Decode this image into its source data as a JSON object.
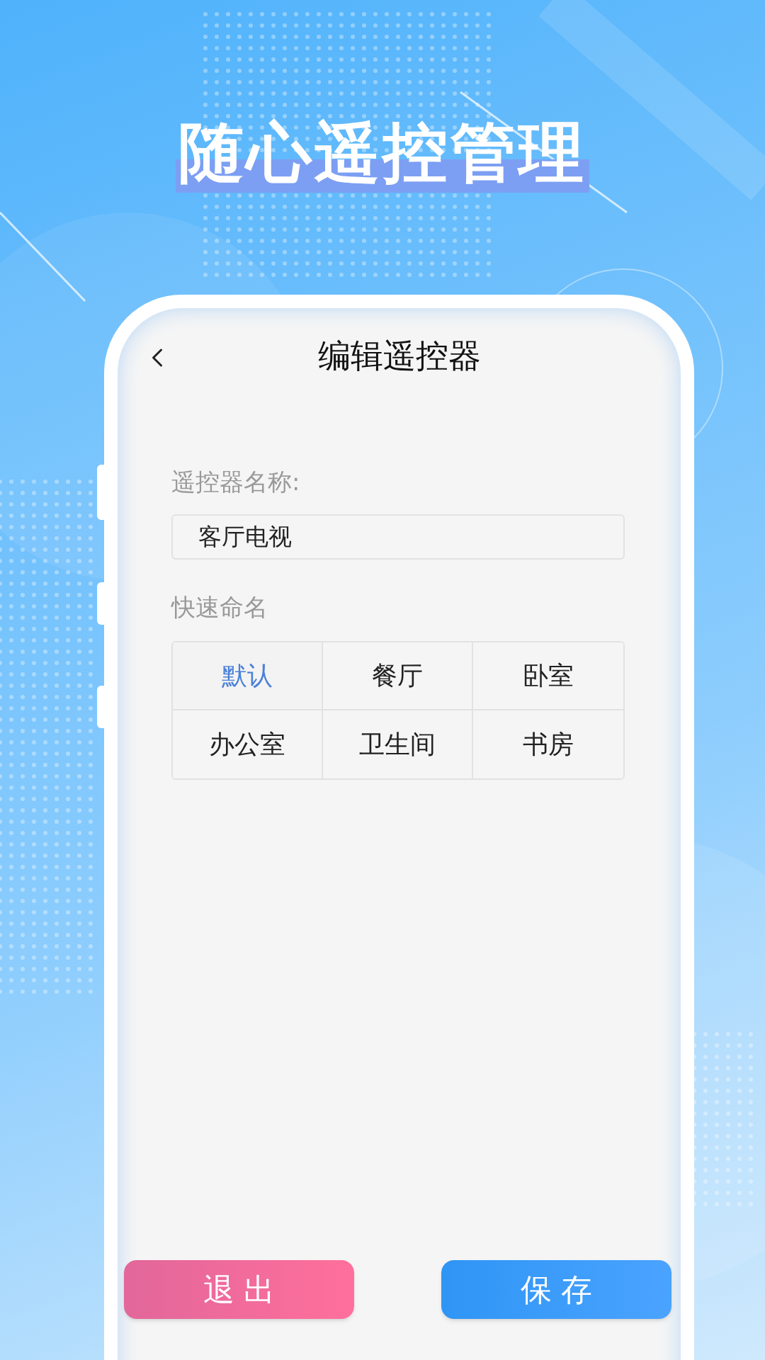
{
  "headline": "随心遥控管理",
  "screen": {
    "title": "编辑遥控器",
    "name_field": {
      "label": "遥控器名称:",
      "value": "客厅电视"
    },
    "quick_names": {
      "label": "快速命名",
      "options": [
        {
          "label": "默认",
          "selected": true
        },
        {
          "label": "餐厅",
          "selected": false
        },
        {
          "label": "卧室",
          "selected": false
        },
        {
          "label": "办公室",
          "selected": false
        },
        {
          "label": "卫生间",
          "selected": false
        },
        {
          "label": "书房",
          "selected": false
        }
      ]
    },
    "buttons": [
      {
        "label": "退 出",
        "kind": "exit"
      },
      {
        "label": "保 存",
        "kind": "save"
      }
    ]
  }
}
